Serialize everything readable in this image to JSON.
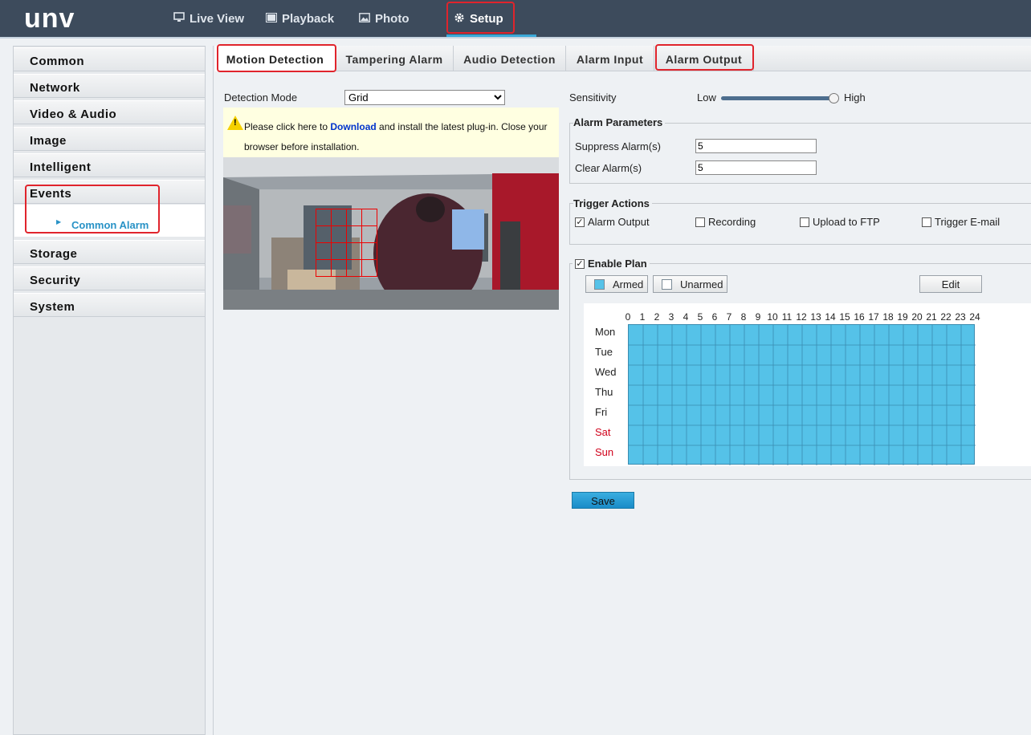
{
  "app": {
    "logo": "unv"
  },
  "topnav": [
    {
      "label": "Live View",
      "icon": "monitor-icon"
    },
    {
      "label": "Playback",
      "icon": "film-icon"
    },
    {
      "label": "Photo",
      "icon": "image-icon"
    },
    {
      "label": "Setup",
      "icon": "gear-icon",
      "selected": true
    }
  ],
  "sidebar": {
    "items": [
      "Common",
      "Network",
      "Video & Audio",
      "Image",
      "Intelligent",
      "Events",
      "Storage",
      "Security",
      "System"
    ],
    "submenu": {
      "label": "Common Alarm",
      "selected": true
    }
  },
  "tabs": [
    "Motion Detection",
    "Tampering Alarm",
    "Audio Detection",
    "Alarm Input",
    "Alarm Output"
  ],
  "active_tab": "Motion Detection",
  "detection": {
    "mode_label": "Detection Mode",
    "mode_value": "Grid",
    "mode_options": [
      "Grid"
    ]
  },
  "plugin": {
    "text_before": "Please click here to ",
    "link": "Download",
    "text_after": " and install the latest plug-in. Close your browser before installation."
  },
  "sensitivity": {
    "label": "Sensitivity",
    "low": "Low",
    "high": "High",
    "level": 1.0
  },
  "alarm_params": {
    "title": "Alarm Parameters",
    "suppress_label": "Suppress Alarm(s)",
    "suppress_value": "5",
    "clear_label": "Clear Alarm(s)",
    "clear_value": "5"
  },
  "trigger": {
    "title": "Trigger Actions",
    "options": [
      {
        "label": "Alarm Output",
        "checked": true
      },
      {
        "label": "Recording",
        "checked": false
      },
      {
        "label": "Upload to FTP",
        "checked": false
      },
      {
        "label": "Trigger E-mail",
        "checked": false
      }
    ]
  },
  "plan": {
    "enable_label": "Enable Plan",
    "enabled": true,
    "armed_label": "Armed",
    "unarmed_label": "Unarmed",
    "edit_label": "Edit",
    "hours": [
      "0",
      "1",
      "2",
      "3",
      "4",
      "5",
      "6",
      "7",
      "8",
      "9",
      "10",
      "11",
      "12",
      "13",
      "14",
      "15",
      "16",
      "17",
      "18",
      "19",
      "20",
      "21",
      "22",
      "23",
      "24"
    ],
    "days": [
      "Mon",
      "Tue",
      "Wed",
      "Thu",
      "Fri",
      "Sat",
      "Sun"
    ],
    "weekend_color": "#d0021b",
    "armed_color": "#55c2e8"
  },
  "save_label": "Save",
  "colors": {
    "header": "#3d4b5c",
    "accent": "#3ba9d8",
    "highlight": "#e0242c"
  }
}
